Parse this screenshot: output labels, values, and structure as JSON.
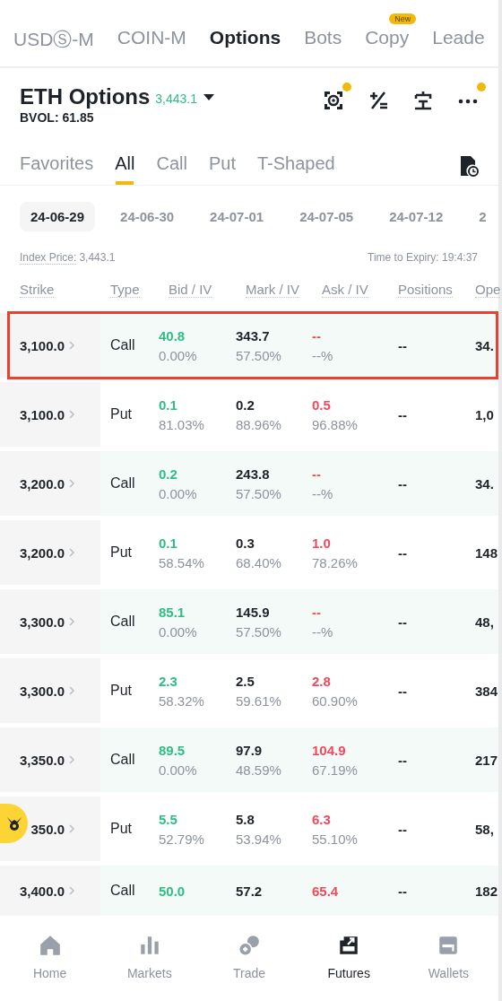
{
  "top_tabs": [
    {
      "label": "USDⓈ-M",
      "selected": false
    },
    {
      "label": "COIN-M",
      "selected": false
    },
    {
      "label": "Options",
      "selected": true
    },
    {
      "label": "Bots",
      "selected": false
    },
    {
      "label": "Copy",
      "selected": false,
      "badge": "New"
    },
    {
      "label": "Leade",
      "selected": false
    }
  ],
  "header": {
    "title": "ETH Options",
    "price": "3,443.1",
    "bvol": "BVOL: 61.85",
    "icons": [
      {
        "kind": "scan",
        "dot": true
      },
      {
        "kind": "plusminus",
        "dot": false
      },
      {
        "kind": "language",
        "dot": false
      },
      {
        "kind": "more",
        "dot": true
      }
    ]
  },
  "filter_tabs": [
    {
      "label": "Favorites",
      "selected": false
    },
    {
      "label": "All",
      "selected": true
    },
    {
      "label": "Call",
      "selected": false
    },
    {
      "label": "Put",
      "selected": false
    },
    {
      "label": "T-Shaped",
      "selected": false
    }
  ],
  "expiry_dates": [
    {
      "label": "24-06-29",
      "selected": true
    },
    {
      "label": "24-06-30",
      "selected": false
    },
    {
      "label": "24-07-01",
      "selected": false
    },
    {
      "label": "24-07-05",
      "selected": false
    },
    {
      "label": "24-07-12",
      "selected": false
    },
    {
      "label": "2",
      "selected": false
    }
  ],
  "index_price": {
    "label": "Index Price:",
    "value": "3,443.1"
  },
  "time_to_expiry": "Time to Expiry: 19:4:37",
  "table": {
    "columns": [
      "Strike",
      "Type",
      "Bid / IV",
      "Mark / IV",
      "Ask / IV",
      "Positions",
      "Ope"
    ],
    "rows": [
      {
        "kind": "call",
        "highlighted": true,
        "strike": "3,100.0",
        "type": "Call",
        "bid": "40.8",
        "bid_iv": "0.00%",
        "mark": "343.7",
        "mark_iv": "57.50%",
        "ask": "--",
        "ask_iv": "--%",
        "positions": "--",
        "column_7": "34."
      },
      {
        "kind": "put",
        "highlighted": false,
        "strike": "3,100.0",
        "type": "Put",
        "bid": "0.1",
        "bid_iv": "81.03%",
        "mark": "0.2",
        "mark_iv": "88.96%",
        "ask": "0.5",
        "ask_iv": "96.88%",
        "positions": "--",
        "column_7": "1,0"
      },
      {
        "kind": "call",
        "highlighted": false,
        "strike": "3,200.0",
        "type": "Call",
        "bid": "0.2",
        "bid_iv": "0.00%",
        "mark": "243.8",
        "mark_iv": "57.50%",
        "ask": "--",
        "ask_iv": "--%",
        "positions": "--",
        "column_7": "34."
      },
      {
        "kind": "put",
        "highlighted": false,
        "strike": "3,200.0",
        "type": "Put",
        "bid": "0.1",
        "bid_iv": "58.54%",
        "mark": "0.3",
        "mark_iv": "68.40%",
        "ask": "1.0",
        "ask_iv": "78.26%",
        "positions": "--",
        "column_7": "148"
      },
      {
        "kind": "call",
        "highlighted": false,
        "strike": "3,300.0",
        "type": "Call",
        "bid": "85.1",
        "bid_iv": "0.00%",
        "mark": "145.9",
        "mark_iv": "57.50%",
        "ask": "--",
        "ask_iv": "--%",
        "positions": "--",
        "column_7": "48,"
      },
      {
        "kind": "put",
        "highlighted": false,
        "strike": "3,300.0",
        "type": "Put",
        "bid": "2.3",
        "bid_iv": "58.32%",
        "mark": "2.5",
        "mark_iv": "59.61%",
        "ask": "2.8",
        "ask_iv": "60.90%",
        "positions": "--",
        "column_7": "384"
      },
      {
        "kind": "call",
        "highlighted": false,
        "strike": "3,350.0",
        "type": "Call",
        "bid": "89.5",
        "bid_iv": "0.00%",
        "mark": "97.9",
        "mark_iv": "48.59%",
        "ask": "104.9",
        "ask_iv": "67.19%",
        "positions": "--",
        "column_7": "217"
      },
      {
        "kind": "put",
        "highlighted": false,
        "strike": "350.0",
        "type": "Put",
        "bid": "5.5",
        "bid_iv": "52.79%",
        "mark": "5.8",
        "mark_iv": "53.94%",
        "ask": "6.3",
        "ask_iv": "55.10%",
        "positions": "--",
        "column_7": "58,"
      },
      {
        "kind": "call",
        "highlighted": false,
        "strike": "3,400.0",
        "type": "Call",
        "bid": "50.0",
        "mark": "57.2",
        "ask": "65.4",
        "positions": "--",
        "column_7": "182"
      }
    ]
  },
  "bottom_nav": [
    {
      "label": "Home",
      "kind": "home",
      "selected": false
    },
    {
      "label": "Markets",
      "kind": "markets",
      "selected": false
    },
    {
      "label": "Trade",
      "kind": "trade",
      "selected": false
    },
    {
      "label": "Futures",
      "kind": "futures",
      "selected": true
    },
    {
      "label": "Wallets",
      "kind": "wallets",
      "selected": false
    }
  ]
}
